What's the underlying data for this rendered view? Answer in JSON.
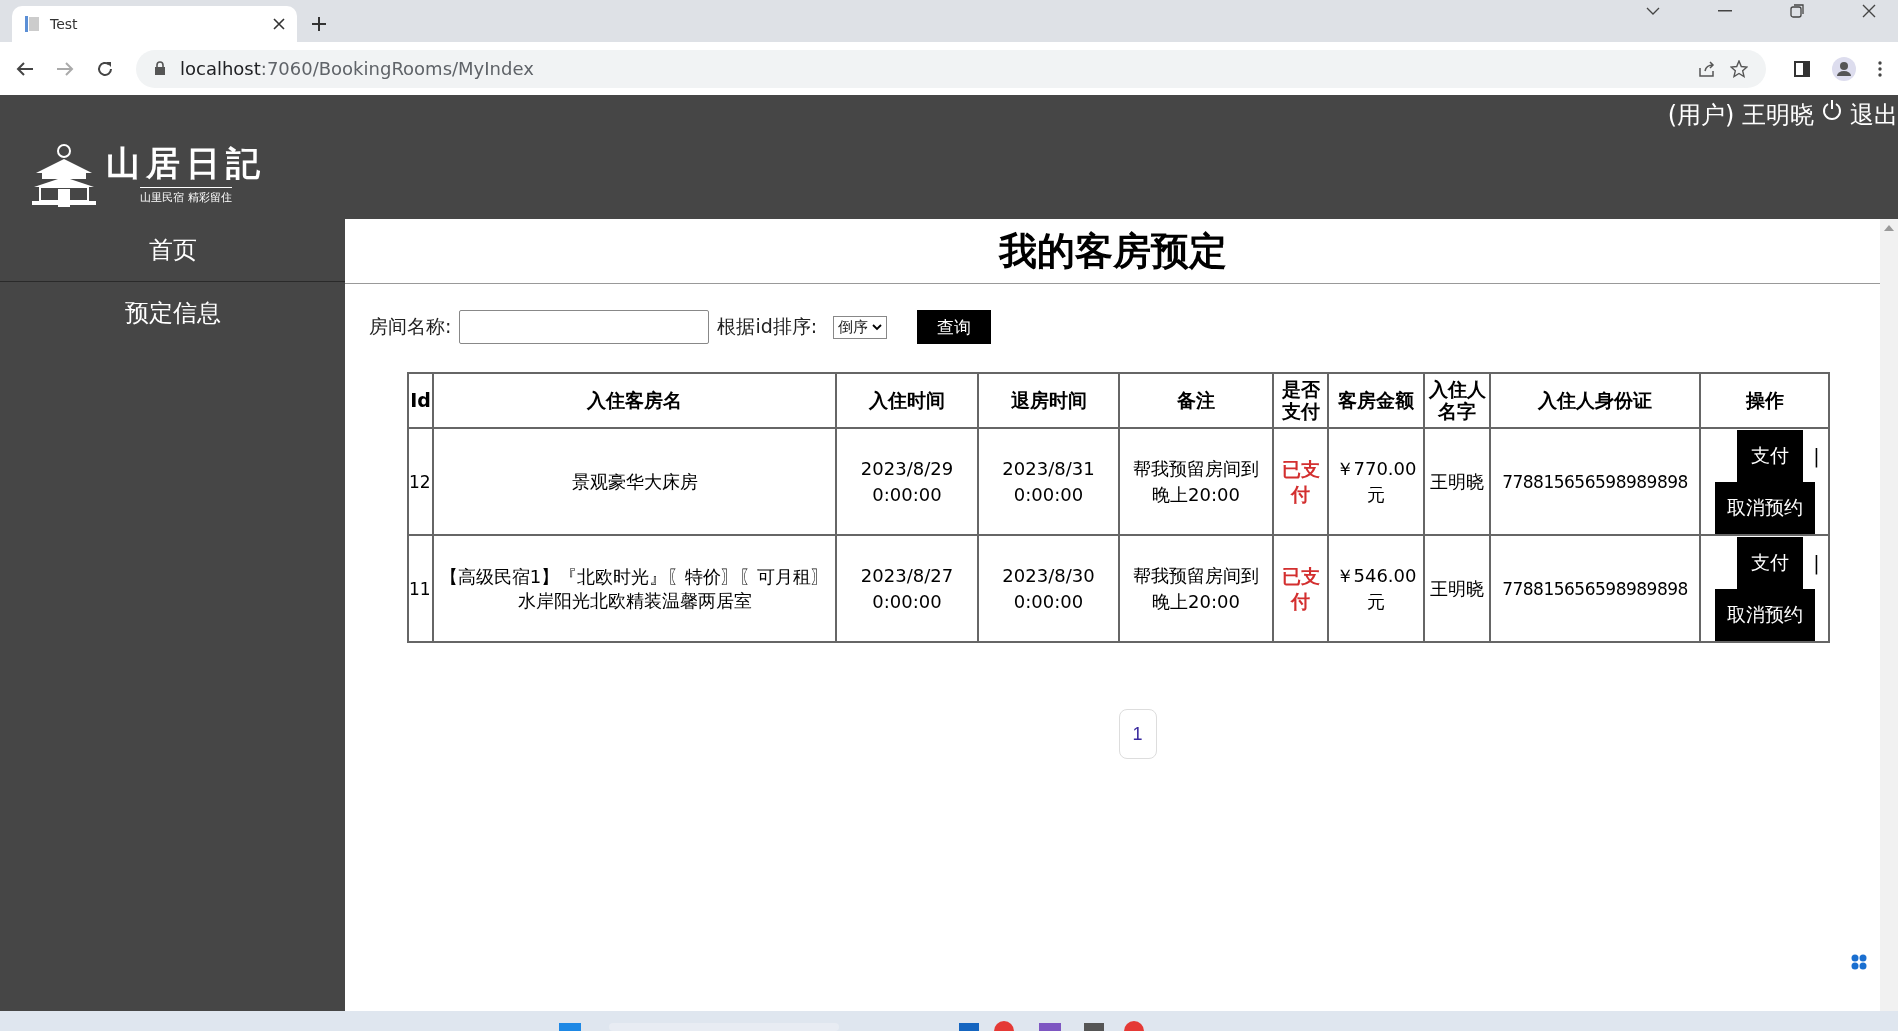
{
  "browser": {
    "tab_title": "Test",
    "url_host": "localhost",
    "url_path": ":7060/BookingRooms/MyIndex"
  },
  "header": {
    "logo_title": "山居日記",
    "logo_subtitle": "山里民宿 精彩留住",
    "user": "(用户) 王明晓",
    "logout": "退出"
  },
  "sidebar": {
    "items": [
      {
        "label": "首页",
        "selected": false
      },
      {
        "label": "预定信息",
        "selected": false
      }
    ]
  },
  "page_title": "我的客房预定",
  "filters": {
    "room_label": "房间名称:",
    "sort_label": "根据id排序:",
    "sort_value": "倒序",
    "query_button": "查询"
  },
  "table": {
    "columns": [
      "Id",
      "入住客房名",
      "入住时间",
      "退房时间",
      "备注",
      "是否支付",
      "客房金额",
      "入住人名字",
      "入住人身份证",
      "操作"
    ],
    "rows": [
      {
        "id": "12",
        "room": "景观豪华大床房",
        "checkin": "2023/8/29 0:00:00",
        "checkout": "2023/8/31 0:00:00",
        "note": "帮我预留房间到晚上20:00",
        "paid_text": "已支付",
        "paid": true,
        "amount": "￥770.00元",
        "guest": "王明晓",
        "id_card": "778815656598989898",
        "actions": [
          "支付",
          "|",
          "取消预约"
        ]
      },
      {
        "id": "11",
        "room": "【高级民宿1】『北欧时光』〖特价〗〖可月租〗水岸阳光北欧精装温馨两居室",
        "checkin": "2023/8/27 0:00:00",
        "checkout": "2023/8/30 0:00:00",
        "note": "帮我预留房间到晚上20:00",
        "paid_text": "已支付",
        "paid": true,
        "amount": "￥546.00元",
        "guest": "王明晓",
        "id_card": "778815656598989898",
        "actions": [
          "支付",
          "|",
          "取消预约"
        ]
      }
    ]
  },
  "pagination": [
    {
      "label": "1",
      "selected": true
    }
  ]
}
